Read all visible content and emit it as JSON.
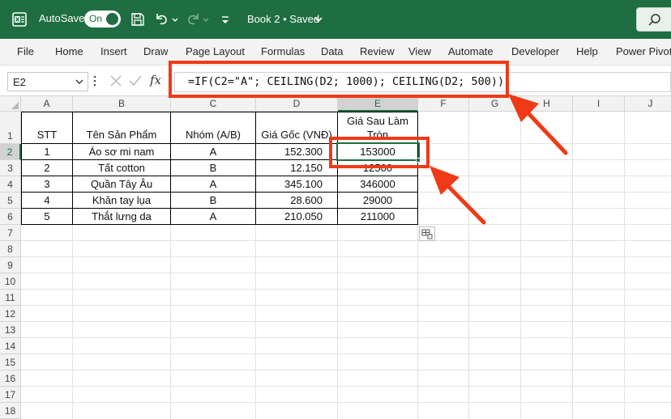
{
  "titlebar": {
    "autosave_label": "AutoSave",
    "autosave_state": "On",
    "document_title": "Book 2 • Saved",
    "icons": [
      "excel-app-icon",
      "save-icon",
      "undo-icon",
      "redo-icon",
      "customize-toolbar-icon",
      "search-icon"
    ]
  },
  "menu": {
    "items": [
      "File",
      "Home",
      "Insert",
      "Draw",
      "Page Layout",
      "Formulas",
      "Data",
      "Review",
      "View",
      "Automate",
      "Developer",
      "Help",
      "Power Pivot"
    ]
  },
  "formula_bar": {
    "name_box": "E2",
    "fx_label": "fx",
    "formula": "=IF(C2=\"A\"; CEILING(D2; 1000); CEILING(D2; 500))"
  },
  "sheet": {
    "columns": [
      "A",
      "B",
      "C",
      "D",
      "E",
      "F",
      "G",
      "H",
      "I",
      "J"
    ],
    "selected_column": "E",
    "rows": [
      "1",
      "2",
      "3",
      "4",
      "5",
      "6",
      "7",
      "8",
      "9",
      "10",
      "11",
      "12",
      "13",
      "14",
      "15",
      "16",
      "17",
      "18"
    ],
    "selected_row": "2",
    "headers": [
      "STT",
      "Tên Sản Phẩm",
      "Nhóm (A/B)",
      "Giá Gốc (VNĐ)",
      "Giá Sau Làm Tròn"
    ],
    "data": [
      [
        "1",
        "Áo sơ mi nam",
        "A",
        "152.300",
        "153000"
      ],
      [
        "2",
        "Tất cotton",
        "B",
        "12.150",
        "12500"
      ],
      [
        "3",
        "Quần Tây Âu",
        "A",
        "345.100",
        "346000"
      ],
      [
        "4",
        "Khăn tay lụa",
        "B",
        "28.600",
        "29000"
      ],
      [
        "5",
        "Thắt lưng da",
        "A",
        "210.050",
        "211000"
      ]
    ],
    "selected_cell": "E2"
  },
  "colors": {
    "excel_green": "#1e6e42",
    "annotation_red": "#f03a17",
    "header_gray": "#f2f2f2"
  }
}
